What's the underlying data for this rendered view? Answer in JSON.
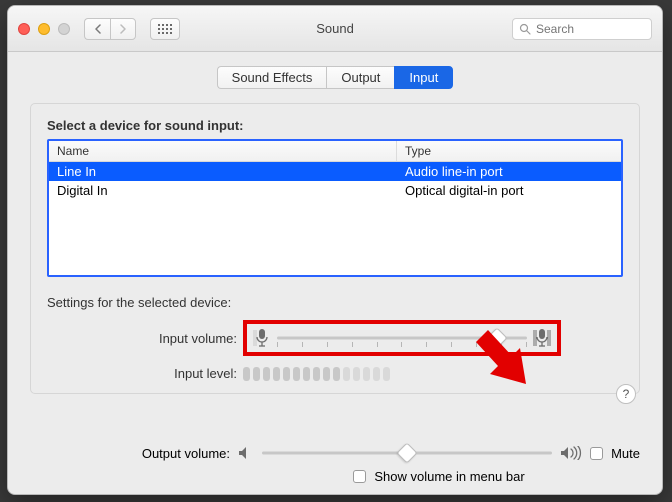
{
  "window": {
    "title": "Sound"
  },
  "search": {
    "placeholder": "Search",
    "value": ""
  },
  "tabs": [
    {
      "label": "Sound Effects",
      "active": false
    },
    {
      "label": "Output",
      "active": false
    },
    {
      "label": "Input",
      "active": true
    }
  ],
  "select_label": "Select a device for sound input:",
  "table": {
    "columns": {
      "name": "Name",
      "type": "Type"
    },
    "rows": [
      {
        "name": "Line In",
        "type": "Audio line-in port",
        "selected": true
      },
      {
        "name": "Digital In",
        "type": "Optical digital-in port",
        "selected": false
      }
    ]
  },
  "settings_label": "Settings for the selected device:",
  "input_volume": {
    "label": "Input volume:",
    "value_percent": 88
  },
  "input_level": {
    "label": "Input level:",
    "active_bars": 10,
    "total_bars": 15
  },
  "output_volume": {
    "label": "Output volume:",
    "value_percent": 50,
    "mute_label": "Mute",
    "muted": false
  },
  "menu_bar": {
    "label": "Show volume in menu bar",
    "checked": false
  },
  "icons": {
    "mic_low": "mic-low",
    "mic_high": "mic-high",
    "spk_low": "speaker-low",
    "spk_high": "speaker-high"
  }
}
